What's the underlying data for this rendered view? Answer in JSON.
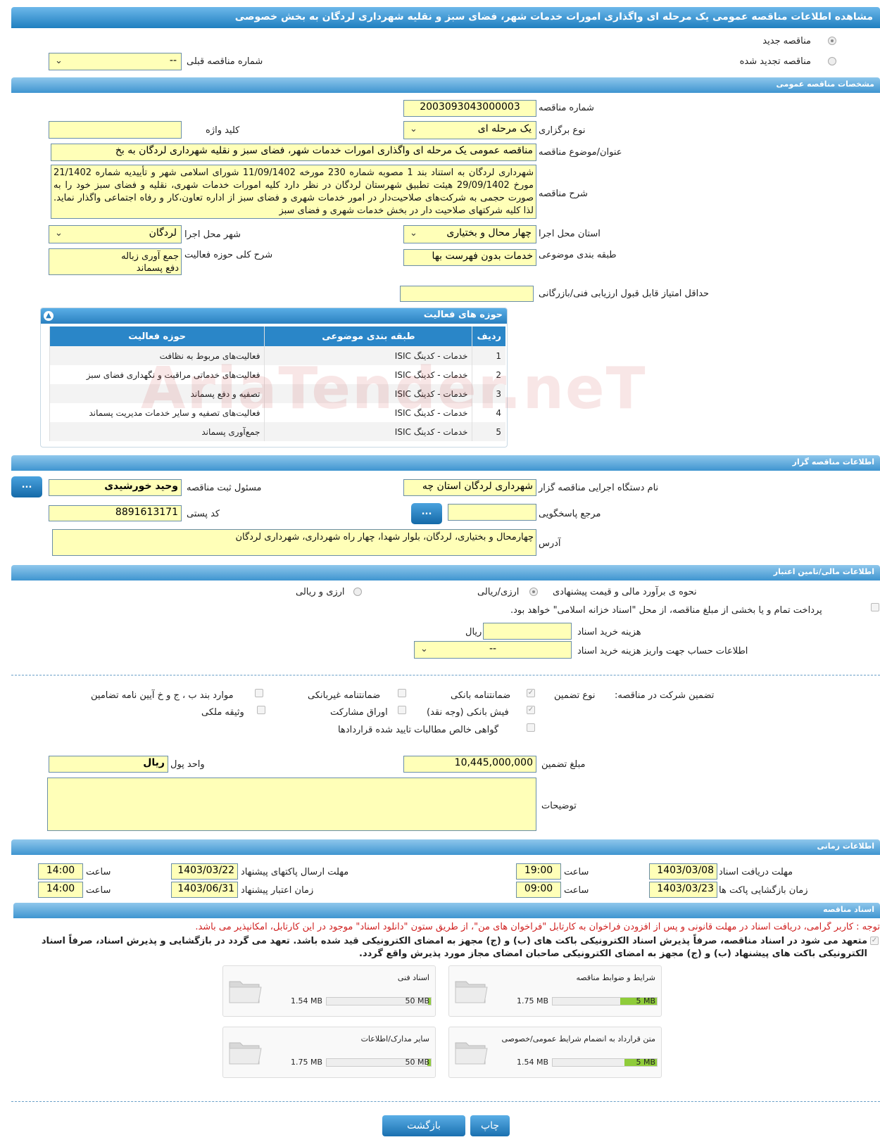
{
  "header": {
    "title": "مشاهده اطلاعات مناقصه عمومی یک مرحله ای واگذاری امورات خدمات شهر، فضای سبز و نقلیه شهرداری لردگان به بخش خصوصی"
  },
  "top": {
    "new_tender": "مناقصه جدید",
    "renewed_tender": "مناقصه تجدید شده",
    "prev_number_label": "شماره مناقصه قبلی",
    "prev_number_value": "--"
  },
  "general": {
    "section": "مشخصات مناقصه عمومی",
    "number_label": "شماره مناقصه",
    "number_value": "2003093043000003",
    "type_label": "نوع برگزاری",
    "type_value": "یک مرحله ای",
    "keyword_label": "کلید واژه",
    "keyword_value": "",
    "subject_label": "عنوان/موضوع مناقصه",
    "subject_value": "مناقصه عمومی یک مرحله ای واگذاری امورات خدمات شهر، فضای سبز و نقلیه شهرداری لردگان به بخ",
    "desc_label": "شرح مناقصه",
    "desc_value": "شهرداری لردگان به استناد بند 1 مصوبه شماره 230 مورخه 11/09/1402 شورای اسلامی شهر و تأییدیه شماره 21/1402 مورخ 29/09/1402 هیئت تطبیق شهرستان لردگان در نظر دارد کلیه امورات خدمات شهری، نقلیه و فضای سبز خود را به صورت حجمی به شرکت‌های صلاحیت‌دار در امور خدمات شهری و فضای سبز از اداره تعاون،کار و رفاه اجتماعی واگذار نماید. لذا کلیه شرکتهای صلاحیت دار در بخش خدمات شهری و فضای سبز",
    "province_label": "استان محل اجرا",
    "province_value": "چهار محال و بختیاری",
    "city_label": "شهر محل اجرا",
    "city_value": "لردگان",
    "category_label": "طبقه بندی موضوعی",
    "category_value": "خدمات بدون فهرست بها",
    "activity_desc_label": "شرح کلی حوزه فعالیت",
    "activity_desc_lines": [
      "جمع آوری زباله",
      "دفع پسماند"
    ],
    "min_score_label": "حداقل امتیاز قابل قبول ارزیابی فنی/بازرگانی",
    "min_score_value": ""
  },
  "activities": {
    "title": "حوزه های فعالیت",
    "headers": [
      "ردیف",
      "طبقه بندی موضوعی",
      "حوزه فعالیت"
    ],
    "rows": [
      [
        "1",
        "خدمات - کدینگ ISIC",
        "فعالیت‌های مربوط به نظافت"
      ],
      [
        "2",
        "خدمات - کدینگ ISIC",
        "فعالیت‌های خدماتی مراقبت و نگهداری فضای سبز"
      ],
      [
        "3",
        "خدمات - کدینگ ISIC",
        "تصفیه و دفع پسماند"
      ],
      [
        "4",
        "خدمات - کدینگ ISIC",
        "فعالیت‌های تصفیه و سایر خدمات مدیریت پسماند"
      ],
      [
        "5",
        "خدمات - کدینگ ISIC",
        "جمع‌آوری پسماند"
      ]
    ]
  },
  "org": {
    "section": "اطلاعات مناقصه گزار",
    "name_label": "نام دستگاه اجرایی مناقصه گزار",
    "name_value": "شهرداری لردگان استان چه",
    "officer_label": "مسئول ثبت مناقصه",
    "officer_value": "وحید خورشیدی",
    "ref_label": "مرجع پاسخگویی",
    "ref_value": "",
    "postal_label": "کد پستی",
    "postal_value": "8891613171",
    "address_label": "آدرس",
    "address_value": "چهارمحال و بختیاری، لردگان، بلوار شهدا، چهار راه شهرداری، شهرداری لردگان",
    "dots": "..."
  },
  "finance": {
    "section": "اطلاعات مالی/تامین اعتبار",
    "method_label": "نحوه ی برآورد مالی و قیمت پیشنهادی",
    "opt1": "ارزی/ریالی",
    "opt2": "ارزی و ریالی",
    "treasury_text": "پرداخت تمام و یا بخشی از مبلغ مناقصه، از محل \"اسناد خزانه اسلامی\" خواهد بود.",
    "doc_cost_label": "هزینه خرید اسناد",
    "doc_cost_unit": "ریال",
    "doc_cost_value": "",
    "account_label": "اطلاعات حساب جهت واریز هزینه خرید اسناد",
    "account_value": "--"
  },
  "guarantee": {
    "title": "تضمین شرکت در مناقصه:",
    "type_label": "نوع تضمین",
    "opts": [
      "ضمانتنامه بانکی",
      "ضمانتنامه غیربانکی",
      "موارد بند ب ، ج و خ آیین نامه تضامین",
      "فیش بانکی (وجه نقد)",
      "اوراق مشارکت",
      "وثیقه ملکی",
      "گواهی خالص مطالبات تایید شده قراردادها"
    ],
    "amount_label": "مبلغ تضمین",
    "amount_value": "10,445,000,000",
    "unit_label": "واحد پول",
    "unit_value": "ریال",
    "notes_label": "توضیحات",
    "notes_value": ""
  },
  "time": {
    "section": "اطلاعات زمانی",
    "doc_deadline_label": "مهلت دریافت اسناد",
    "doc_deadline_date": "1403/03/08",
    "doc_deadline_time": "19:00",
    "send_deadline_label": "مهلت ارسال پاکتهای پیشنهاد",
    "send_deadline_date": "1403/03/22",
    "send_deadline_time": "14:00",
    "open_label": "زمان بازگشایی پاکت ها",
    "open_date": "1403/03/23",
    "open_time": "09:00",
    "validity_label": "زمان اعتبار پیشنهاد",
    "validity_date": "1403/06/31",
    "validity_time": "14:00",
    "hour_label": "ساعت"
  },
  "docs": {
    "section": "اسناد مناقصه",
    "note": "توجه : کاربر گرامی، دریافت اسناد در مهلت قانونی و پس از افزودن فراخوان به کارتابل \"فراخوان های من\"، از طریق ستون \"دانلود اسناد\" موجود در این کارتابل، امکانپذیر می باشد.",
    "pledge": "متعهد می شود در اسناد مناقصه، صرفاً پذیرش اسناد الکترونیکی باکت های (ب) و (ج) مجهز به امضای الکترونیکی قید شده باشد. تعهد می گردد در بازگشایی و پذیرش اسناد، صرفاً اسناد الکترونیکی باکت های پیشنهاد (ب) و (ج) مجهز به امضای الکترونیکی صاحبان امضای مجاز مورد پذیرش واقع گردد.",
    "files": [
      {
        "name": "شرایط و ضوابط مناقصه",
        "max": "5 MB",
        "size": "1.75 MB",
        "ratio": 0.35
      },
      {
        "name": "اسناد فنی",
        "max": "50 MB",
        "size": "1.54 MB",
        "ratio": 0.03
      },
      {
        "name": "متن قرارداد به انضمام شرایط عمومی/خصوصی",
        "max": "5 MB",
        "size": "1.54 MB",
        "ratio": 0.31
      },
      {
        "name": "سایر مدارک/اطلاعات",
        "max": "50 MB",
        "size": "1.75 MB",
        "ratio": 0.035
      }
    ]
  },
  "footer": {
    "print": "چاپ",
    "back": "بازگشت"
  },
  "watermark": "AriaTender.neT",
  "colors": {
    "field": "#ffffb8",
    "accent": "#3f95d0"
  }
}
